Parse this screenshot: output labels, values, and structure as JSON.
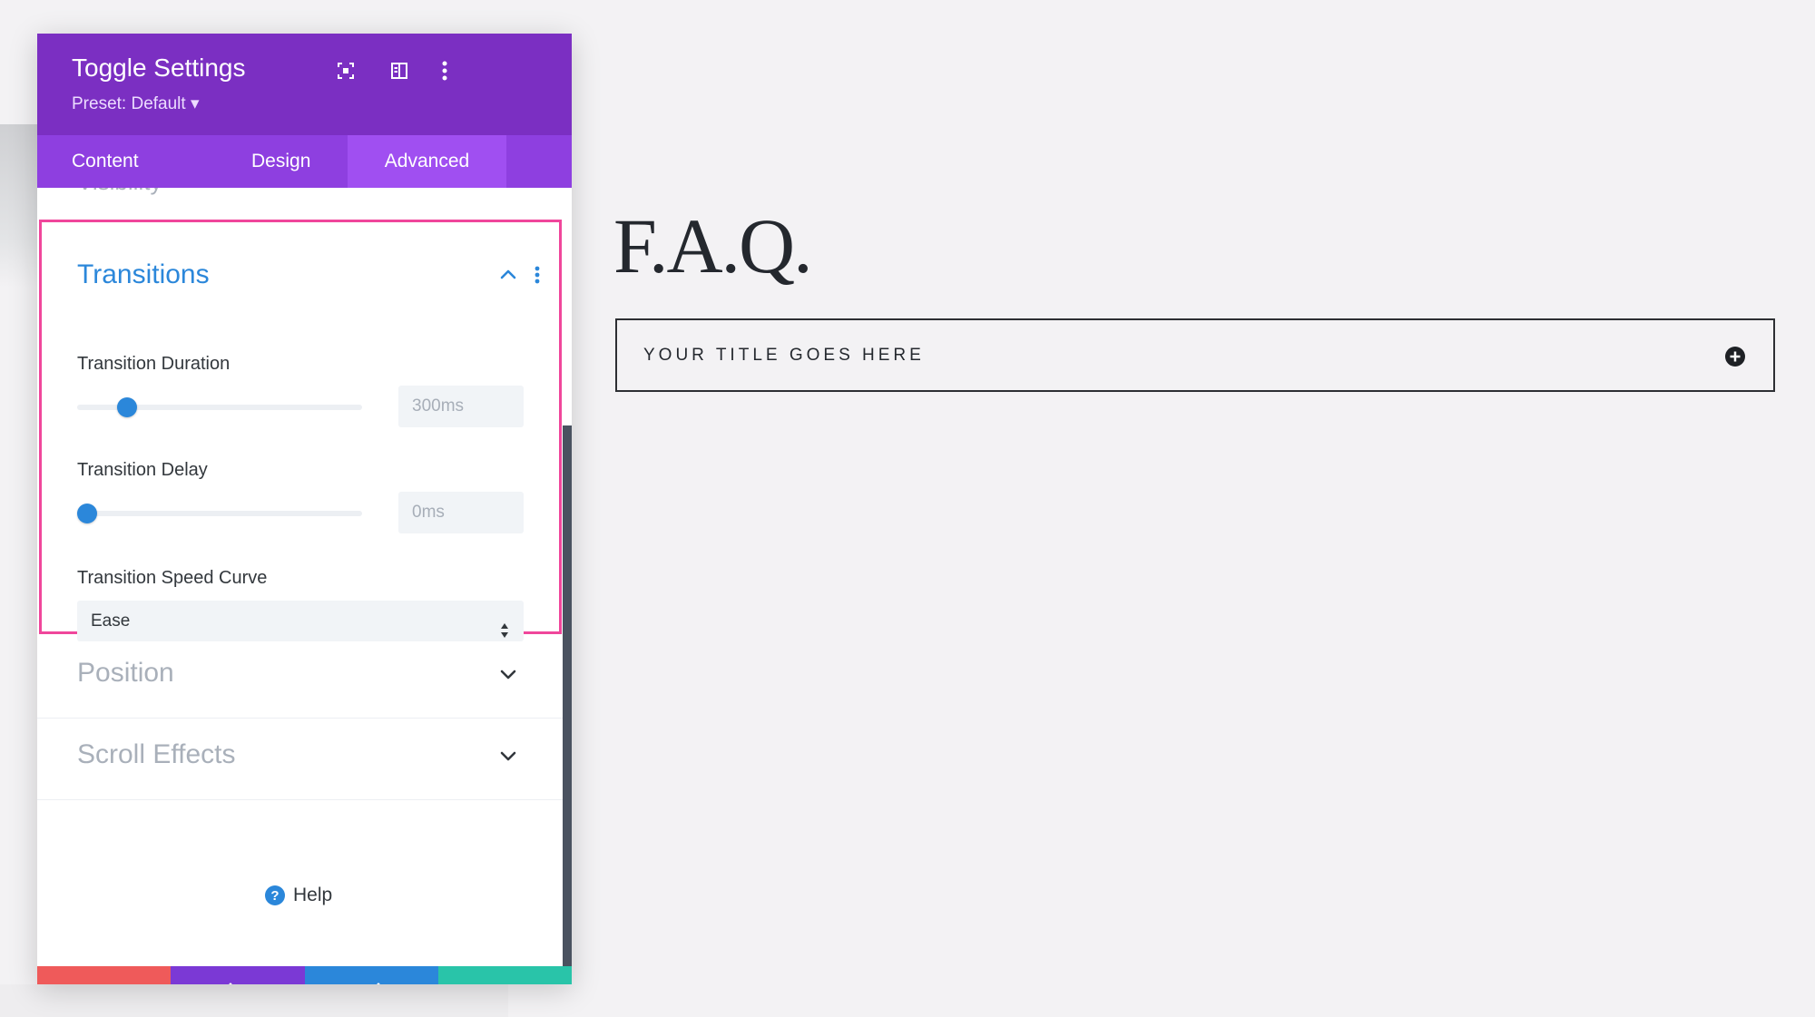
{
  "panel": {
    "title": "Toggle Settings",
    "preset": "Preset: Default ▾",
    "tabs": [
      {
        "label": "Content",
        "active": false
      },
      {
        "label": "Design",
        "active": false
      },
      {
        "label": "Advanced",
        "active": true
      }
    ],
    "peek_section": "Visibility",
    "transitions": {
      "title": "Transitions",
      "duration": {
        "label": "Transition Duration",
        "value": "300ms",
        "slider_fraction": 0.15
      },
      "delay": {
        "label": "Transition Delay",
        "value": "0ms",
        "slider_fraction": 0.0
      },
      "speed_curve": {
        "label": "Transition Speed Curve",
        "selected": "Ease"
      }
    },
    "collapsed_sections": [
      "Position",
      "Scroll Effects"
    ],
    "help_label": "Help",
    "footer": {
      "icons": [
        "close-icon",
        "undo-icon",
        "redo-icon",
        "check-icon"
      ],
      "colors": [
        "#ef5a5a",
        "#7b39d5",
        "#2b87da",
        "#29c4a9"
      ]
    },
    "colors": {
      "header": "#7b2fc2",
      "tabs": "#8e3fe0",
      "accent": "#2b87da",
      "highlight": "#f0469b"
    }
  },
  "page": {
    "heading": "F.A.Q.",
    "toggle_title": "YOUR TITLE GOES HERE"
  }
}
